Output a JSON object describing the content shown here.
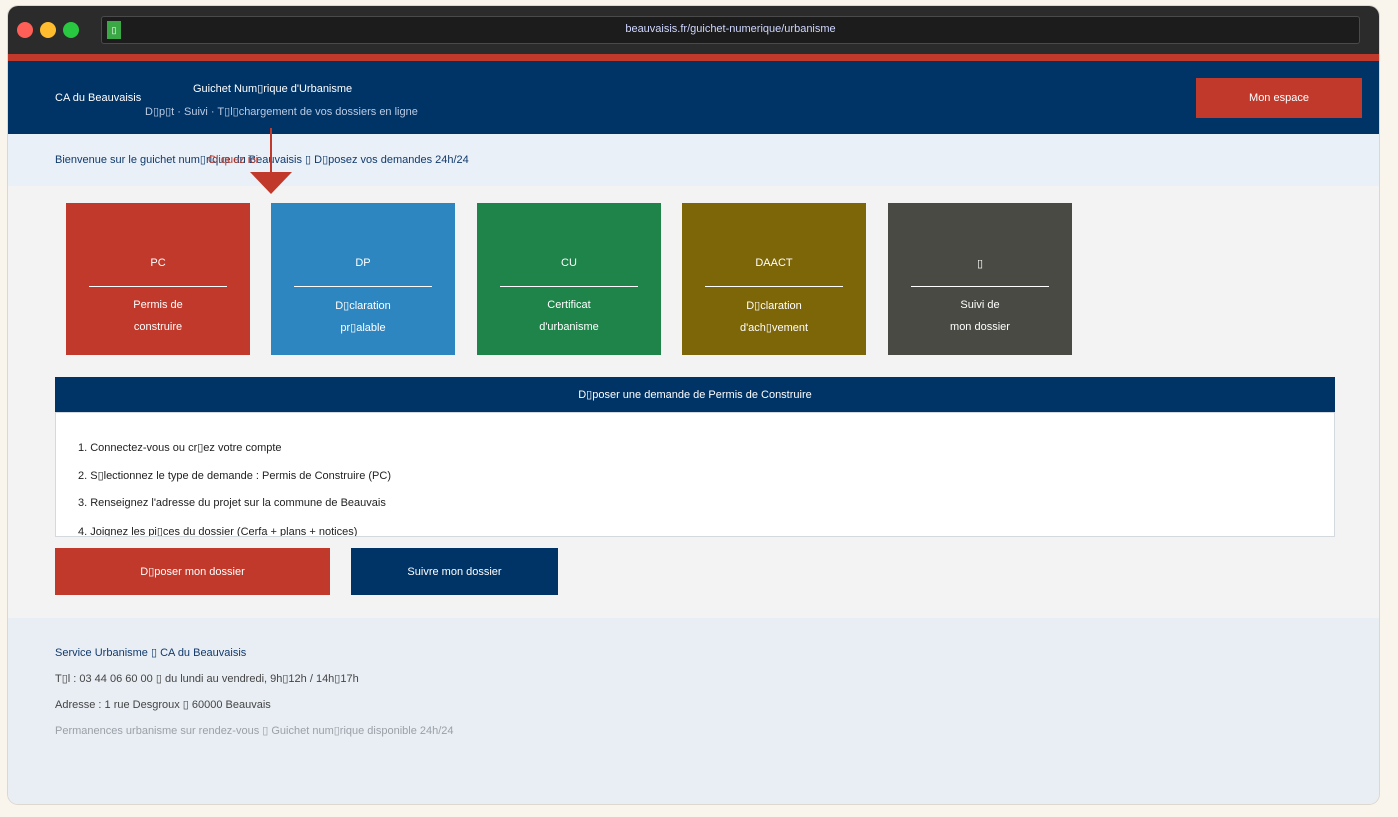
{
  "browser": {
    "url": "beauvaisis.fr/guichet-numerique/urbanisme",
    "lock_glyph": "▯"
  },
  "header": {
    "brand": "CA du Beauvaisis",
    "title": "Guichet Num▯rique d'Urbanisme",
    "subtitle": "D▯p▯t · Suivi · T▯l▯chargement de vos dossiers en ligne",
    "account_button": "Mon espace"
  },
  "welcome": {
    "text": "Bienvenue sur le guichet num▯rique du Beauvaisis ▯ D▯posez vos demandes 24h/24",
    "annotation": "Cliquez ici"
  },
  "tiles": [
    {
      "code": "PC",
      "line1": "Permis de",
      "line2": "construire",
      "color": "#c0392b"
    },
    {
      "code": "DP",
      "line1": "D▯claration",
      "line2": "pr▯alable",
      "color": "#2e86c1"
    },
    {
      "code": "CU",
      "line1": "Certificat",
      "line2": "d'urbanisme",
      "color": "#1e8449"
    },
    {
      "code": "DAACT",
      "line1": "D▯claration",
      "line2": "d'ach▯vement",
      "color": "#7d6608"
    },
    {
      "code": "▯",
      "line1": "Suivi de",
      "line2": "mon dossier",
      "color": "#4a4a44"
    }
  ],
  "panel": {
    "title": "D▯poser une demande de Permis de Construire",
    "steps": [
      "1. Connectez-vous ou cr▯ez votre compte",
      "2. S▯lectionnez le type de demande : Permis de Construire (PC)",
      "3. Renseignez l'adresse du projet sur la commune de Beauvais",
      "4. Joignez les pi▯ces du dossier (Cerfa + plans + notices)"
    ]
  },
  "actions": {
    "deposit": "D▯poser mon dossier",
    "follow": "Suivre mon dossier"
  },
  "footer": {
    "service": "Service Urbanisme ▯ CA du Beauvaisis",
    "phone": "T▯l : 03 44 06 60 00 ▯ du lundi au vendredi, 9h▯12h / 14h▯17h",
    "address": "Adresse : 1 rue Desgroux ▯ 60000 Beauvais",
    "note": "Permanences urbanisme sur rendez-vous ▯ Guichet num▯rique disponible 24h/24"
  }
}
